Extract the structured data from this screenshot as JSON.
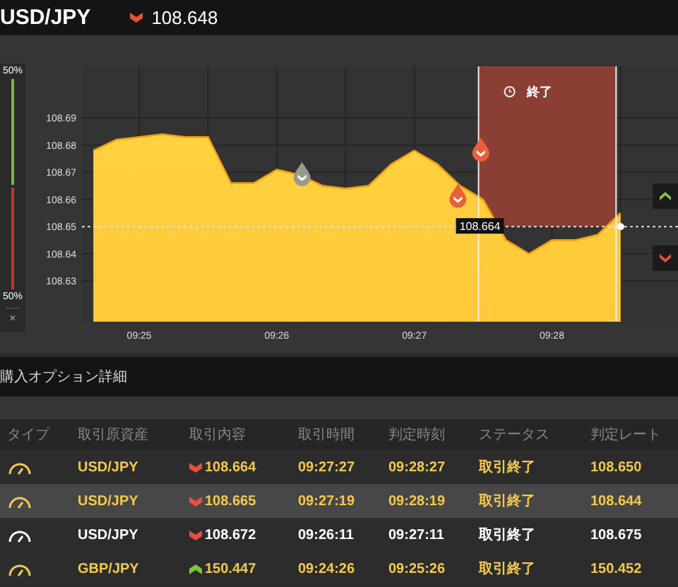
{
  "header": {
    "symbol": "USD/JPY",
    "up": false,
    "rate": "108.648"
  },
  "sentiment": {
    "top_label": "50%",
    "bottom_label": "50%",
    "level": 0.5,
    "close": "×"
  },
  "chart": {
    "chart_data": {
      "type": "area",
      "categories": [
        null,
        null,
        "09:25",
        null,
        null,
        null,
        null,
        null,
        "09:26",
        null,
        null,
        null,
        null,
        null,
        "09:27",
        null,
        null,
        null,
        null,
        null,
        "09:28",
        null,
        null,
        null
      ],
      "values": [
        108.678,
        108.682,
        108.683,
        108.684,
        108.683,
        108.683,
        108.666,
        108.666,
        108.671,
        108.669,
        108.665,
        108.664,
        108.665,
        108.673,
        108.678,
        108.673,
        108.665,
        108.66,
        108.645,
        108.64,
        108.645,
        108.645,
        108.647,
        108.655
      ],
      "ylim": [
        108.615,
        108.709
      ],
      "grid": true,
      "ref_lines": [
        {
          "axis": "y",
          "value": 108.65
        }
      ],
      "yticks": [
        108.63,
        108.64,
        108.65,
        108.66,
        108.67,
        108.68,
        108.69
      ]
    },
    "expiry_label": "終了",
    "price_label": "108.664",
    "markers": [
      {
        "up": false,
        "active": false
      },
      {
        "up": false,
        "active": true
      },
      {
        "up": false,
        "active": true
      }
    ]
  },
  "details": {
    "title": "購入オプション詳細",
    "columns": [
      "タイプ",
      "取引原資産",
      "取引内容",
      "取引時間",
      "判定時刻",
      "ステータス",
      "判定レート"
    ],
    "rows": [
      {
        "asset": "USD/JPY",
        "up": false,
        "strike": "108.664",
        "start": "09:27:27",
        "end": "09:28:27",
        "status": "取引終了",
        "result": "108.650",
        "highlighted": true,
        "selected": false
      },
      {
        "asset": "USD/JPY",
        "up": false,
        "strike": "108.665",
        "start": "09:27:19",
        "end": "09:28:19",
        "status": "取引終了",
        "result": "108.644",
        "highlighted": true,
        "selected": true
      },
      {
        "asset": "USD/JPY",
        "up": false,
        "strike": "108.672",
        "start": "09:26:11",
        "end": "09:27:11",
        "status": "取引終了",
        "result": "108.675",
        "highlighted": false,
        "selected": false
      },
      {
        "asset": "GBP/JPY",
        "up": true,
        "strike": "150.447",
        "start": "09:24:26",
        "end": "09:25:26",
        "status": "取引終了",
        "result": "150.452",
        "highlighted": true,
        "selected": false
      }
    ]
  }
}
